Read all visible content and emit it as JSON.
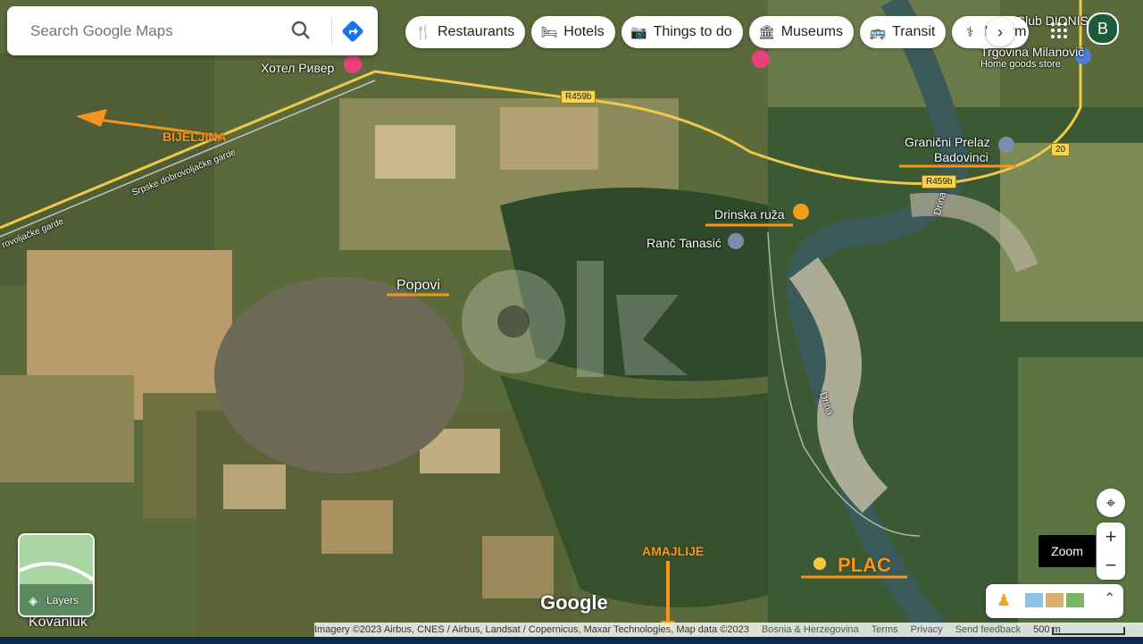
{
  "search": {
    "placeholder": "Search Google Maps"
  },
  "chips": [
    {
      "label": "Restaurants",
      "icon": "fork-knife-icon"
    },
    {
      "label": "Hotels",
      "icon": "bed-icon"
    },
    {
      "label": "Things to do",
      "icon": "camera-icon"
    },
    {
      "label": "Museums",
      "icon": "museum-icon"
    },
    {
      "label": "Transit",
      "icon": "bus-icon"
    },
    {
      "label": "Pharm",
      "icon": "pharmacy-icon"
    }
  ],
  "account": {
    "initial": "B"
  },
  "places": {
    "hotel_river": "Хотел Ривер",
    "club_dionis": "Club DIONIS",
    "trgovina": "Trgovina Milanović",
    "trgovina_sub": "Home goods store",
    "granicni": "Granični Prelaz",
    "badovinci": "Badovinci",
    "drinska_ruza": "Drinska ruža",
    "ranc_tanasic": "Ranč Tanasić",
    "popovi": "Popovi",
    "kovanluk": "Kovanluk",
    "drina": "Drina",
    "road_srpske": "Srpske dobrovoljačke garde",
    "road_srpske_short": "rovoljačke garde"
  },
  "roads": {
    "r459b": "R459b",
    "r20": "20"
  },
  "annotations": {
    "bijeljina": "BIJELJINA",
    "amajlije": "AMAJLIJE",
    "plac": "PLAC"
  },
  "layers": {
    "label": "Layers"
  },
  "zoom": {
    "tooltip": "Zoom",
    "plus": "+",
    "minus": "−"
  },
  "logo": "Google",
  "attribution": {
    "imagery": "Imagery ©2023 Airbus, CNES / Airbus, Landsat / Copernicus, Maxar Technologies, Map data ©2023",
    "region": "Bosnia & Herzegovina",
    "terms": "Terms",
    "privacy": "Privacy",
    "feedback": "Send feedback",
    "scale": "500 m"
  },
  "colors": {
    "accent": "#f7941d",
    "directions": "#1a73e8",
    "avatar": "#1e5b3c"
  }
}
